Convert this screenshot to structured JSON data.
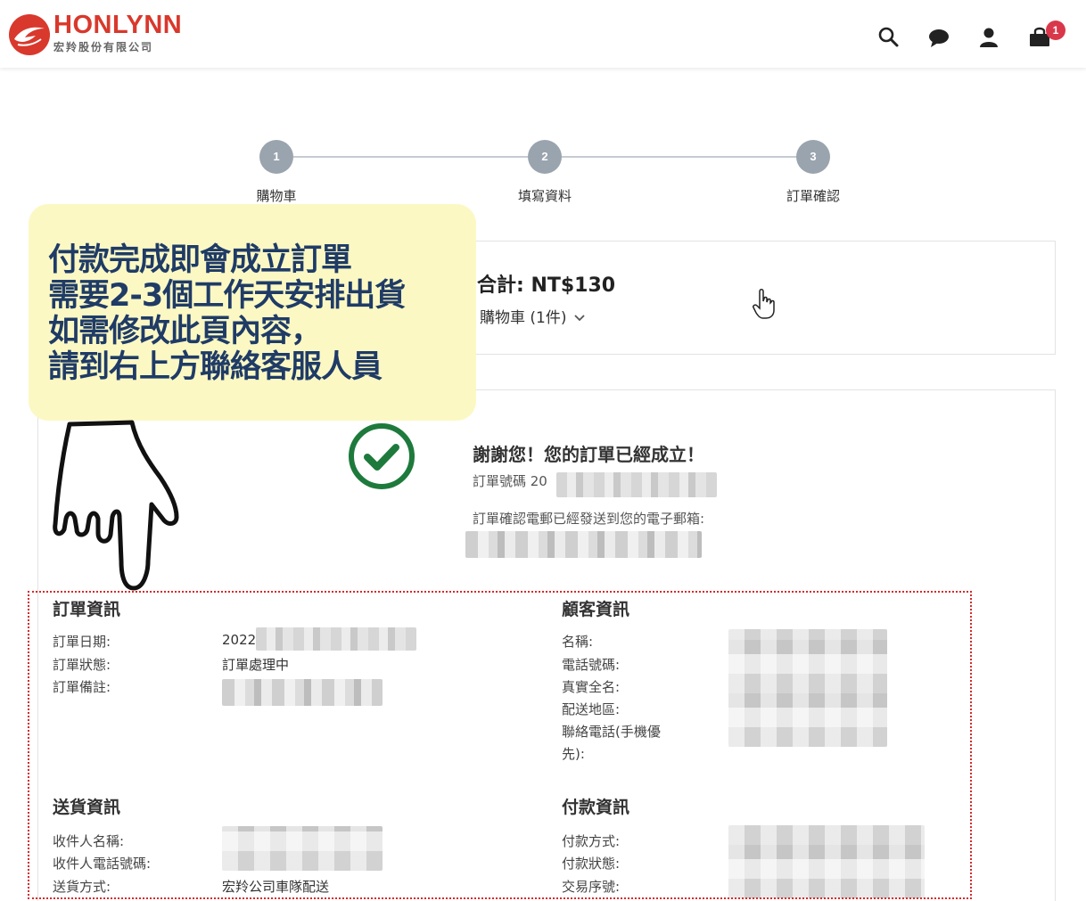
{
  "header": {
    "brand_name": "HONLYNN",
    "brand_sub": "宏羚股份有限公司",
    "icons": [
      "search-icon",
      "chat-icon",
      "user-icon",
      "cart-icon"
    ],
    "cart_count": "1",
    "brand_color": "#d9382c"
  },
  "stepper": {
    "steps": [
      {
        "number": "1",
        "label": "購物車"
      },
      {
        "number": "2",
        "label": "填寫資料"
      },
      {
        "number": "3",
        "label": "訂單確認"
      }
    ]
  },
  "summary": {
    "total": "合計: NT$130",
    "cart_toggle": "購物車 (1件)"
  },
  "callout": {
    "lines": [
      "付款完成即會成立訂單",
      "需要2-3個工作天安排出貨",
      "如需修改此頁內容，",
      "請到右上方聯絡客服人員"
    ],
    "bg_color": "#fbf8c4",
    "text_color": "#1f3b66"
  },
  "confirmation": {
    "title": "謝謝您！您的訂單已經成立！",
    "order_no_prefix": "訂單號碼 20",
    "email_note": "訂單確認電郵已經發送到您的電子郵箱:"
  },
  "order_info": {
    "title": "訂單資訊",
    "fields": [
      {
        "label": "訂單日期:",
        "value": "2022"
      },
      {
        "label": "訂單狀態:",
        "value": "訂單處理中"
      },
      {
        "label": "訂單備註:",
        "value": ""
      }
    ]
  },
  "customer_info": {
    "title": "顧客資訊",
    "fields": [
      {
        "label": "名稱:"
      },
      {
        "label": "電話號碼:"
      },
      {
        "label": "真實全名:"
      },
      {
        "label": "配送地區:"
      },
      {
        "label": "聯絡電話(手機優"
      },
      {
        "label": "先):"
      }
    ]
  },
  "delivery_info": {
    "title": "送貨資訊",
    "fields": [
      {
        "label": "收件人名稱:",
        "value": ""
      },
      {
        "label": "收件人電話號碼:",
        "value": ""
      },
      {
        "label": "送貨方式:",
        "value": "宏羚公司車隊配送"
      }
    ]
  },
  "payment_info": {
    "title": "付款資訊",
    "fields": [
      {
        "label": "付款方式:"
      },
      {
        "label": "付款狀態:"
      },
      {
        "label": "交易序號:"
      }
    ]
  }
}
